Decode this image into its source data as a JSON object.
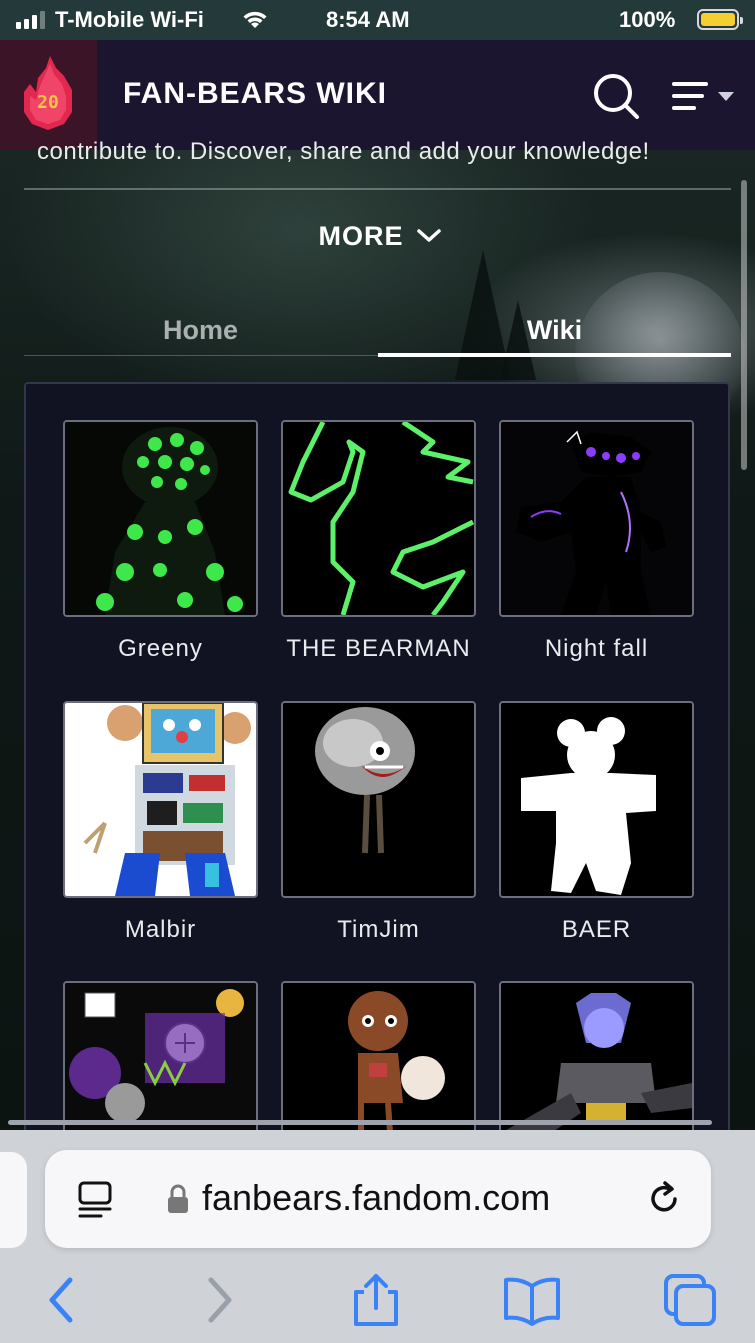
{
  "status_bar": {
    "carrier": "T-Mobile Wi-Fi",
    "time": "8:54 AM",
    "battery": "100%"
  },
  "header": {
    "logo_badge": "20",
    "title": "FAN-BEARS WIKI",
    "search_icon": "search-icon",
    "menu_icon": "menu-icon"
  },
  "intro": {
    "text": "contribute to. Discover, share and add your knowledge!",
    "more_label": "MORE"
  },
  "tabs": [
    {
      "label": "Home",
      "active": false
    },
    {
      "label": "Wiki",
      "active": true
    }
  ],
  "gallery": {
    "items": [
      {
        "caption": "Greeny"
      },
      {
        "caption": "THE BEARMAN"
      },
      {
        "caption": "Night fall"
      },
      {
        "caption": "Malbir"
      },
      {
        "caption": "TimJim"
      },
      {
        "caption": "BAER"
      },
      {
        "caption": ""
      },
      {
        "caption": ""
      },
      {
        "caption": ""
      }
    ]
  },
  "browser": {
    "url": "fanbears.fandom.com",
    "accent": "#3b82f6"
  },
  "colors": {
    "header_bg": "#1b1530",
    "status_bg": "#243a3a",
    "accent_green": "#5df06a",
    "accent_purple": "#8c3cff"
  }
}
